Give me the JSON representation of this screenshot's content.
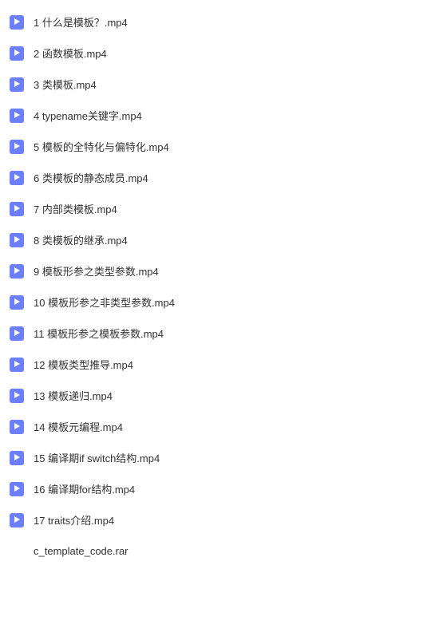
{
  "files": [
    {
      "name": "1 什么是模板？.mp4",
      "type": "video"
    },
    {
      "name": "2 函数模板.mp4",
      "type": "video"
    },
    {
      "name": "3 类模板.mp4",
      "type": "video"
    },
    {
      "name": "4 typename关键字.mp4",
      "type": "video"
    },
    {
      "name": "5 模板的全特化与偏特化.mp4",
      "type": "video"
    },
    {
      "name": "6 类模板的静态成员.mp4",
      "type": "video"
    },
    {
      "name": "7 内部类模板.mp4",
      "type": "video"
    },
    {
      "name": "8 类模板的继承.mp4",
      "type": "video"
    },
    {
      "name": "9 模板形参之类型参数.mp4",
      "type": "video"
    },
    {
      "name": "10 模板形参之非类型参数.mp4",
      "type": "video"
    },
    {
      "name": "11 模板形参之模板参数.mp4",
      "type": "video"
    },
    {
      "name": "12 模板类型推导.mp4",
      "type": "video"
    },
    {
      "name": "13 模板递归.mp4",
      "type": "video"
    },
    {
      "name": "14 模板元编程.mp4",
      "type": "video"
    },
    {
      "name": "15 编译期if switch结构.mp4",
      "type": "video"
    },
    {
      "name": "16 编译期for结构.mp4",
      "type": "video"
    },
    {
      "name": "17 traits介绍.mp4",
      "type": "video"
    },
    {
      "name": "c_template_code.rar",
      "type": "archive"
    }
  ]
}
